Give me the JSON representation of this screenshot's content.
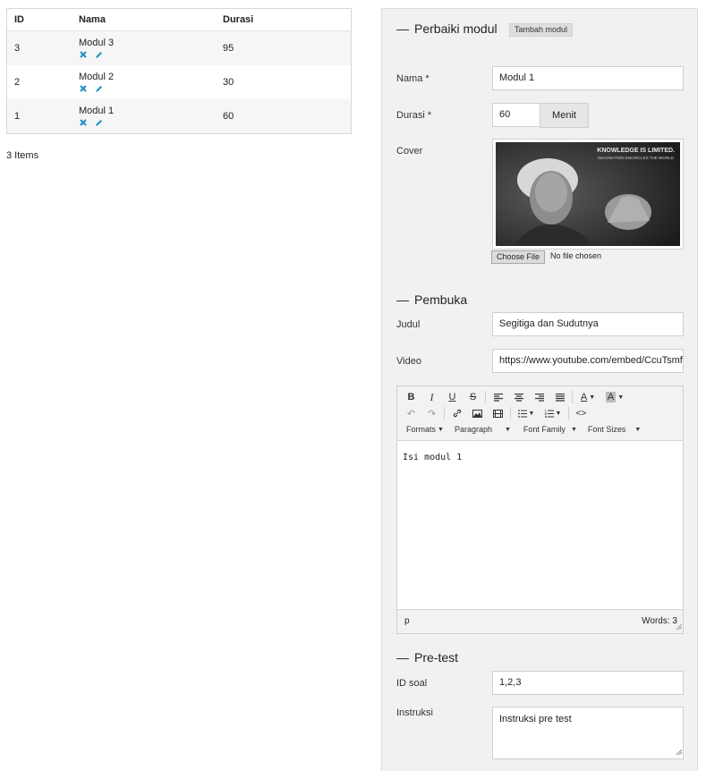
{
  "table": {
    "headers": {
      "id": "ID",
      "nama": "Nama",
      "durasi": "Durasi"
    },
    "rows": [
      {
        "id": "3",
        "nama": "Modul 3",
        "durasi": "95"
      },
      {
        "id": "2",
        "nama": "Modul 2",
        "durasi": "30"
      },
      {
        "id": "1",
        "nama": "Modul 1",
        "durasi": "60"
      }
    ],
    "count_label": "3 Items"
  },
  "form": {
    "title": "Perbaiki modul",
    "add_button": "Tambah modul",
    "nama": {
      "label": "Nama *",
      "value": "Modul 1"
    },
    "durasi": {
      "label": "Durasi *",
      "value": "60",
      "unit": "Menit"
    },
    "cover": {
      "label": "Cover",
      "image_text_1": "KNOWLEDGE IS LIMITED.",
      "image_text_2": "IMAGINATION ENCIRCLES THE WORLD.",
      "choose_button": "Choose File",
      "no_file": "No file chosen"
    },
    "pembuka": {
      "title": "Pembuka",
      "judul": {
        "label": "Judul",
        "value": "Segitiga dan Sudutnya"
      },
      "video": {
        "label": "Video",
        "value": "https://www.youtube.com/embed/CcuTsmf"
      }
    },
    "editor": {
      "menus": [
        "Formats",
        "Paragraph",
        "Font Family",
        "Font Sizes"
      ],
      "content": "Isi modul 1",
      "path": "p",
      "words": "Words: 3"
    },
    "pretest": {
      "title": "Pre-test",
      "id_soal": {
        "label": "ID soal",
        "value": "1,2,3"
      },
      "instruksi": {
        "label": "Instruksi",
        "value": "Instruksi pre test"
      }
    }
  },
  "colors": {
    "action_icon": "#1f8fc0",
    "panel_bg": "#f1f1f1"
  }
}
